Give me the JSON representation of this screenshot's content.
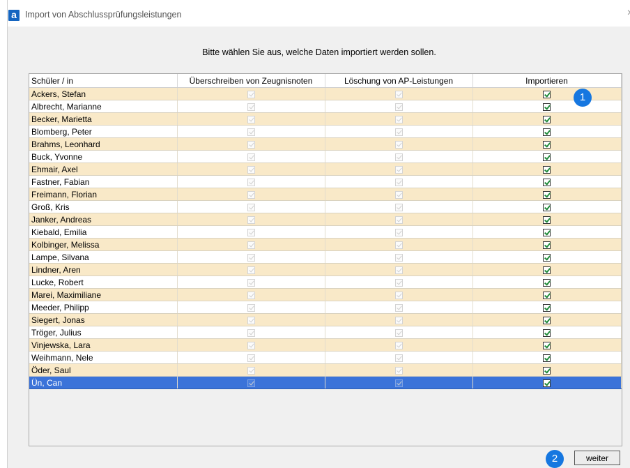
{
  "window": {
    "title": "Import von Abschlussprüfungsleistungen",
    "app_icon_letter": "a",
    "close_glyph": "×"
  },
  "instruction": "Bitte wählen Sie aus, welche Daten importiert werden sollen.",
  "table": {
    "columns": [
      "Schüler / in",
      "Überschreiben von Zeugnisnoten",
      "Löschung von AP-Leistungen",
      "Importieren"
    ],
    "rows": [
      {
        "name": "Ackers, Stefan",
        "ueberschreiben": false,
        "loeschung": false,
        "importieren": true
      },
      {
        "name": "Albrecht, Marianne",
        "ueberschreiben": false,
        "loeschung": false,
        "importieren": true
      },
      {
        "name": "Becker, Marietta",
        "ueberschreiben": false,
        "loeschung": false,
        "importieren": true
      },
      {
        "name": "Blomberg, Peter",
        "ueberschreiben": false,
        "loeschung": false,
        "importieren": true
      },
      {
        "name": "Brahms, Leonhard",
        "ueberschreiben": false,
        "loeschung": false,
        "importieren": true
      },
      {
        "name": "Buck, Yvonne",
        "ueberschreiben": false,
        "loeschung": false,
        "importieren": true
      },
      {
        "name": "Ehmair, Axel",
        "ueberschreiben": false,
        "loeschung": false,
        "importieren": true
      },
      {
        "name": "Fastner, Fabian",
        "ueberschreiben": false,
        "loeschung": false,
        "importieren": true
      },
      {
        "name": "Freimann, Florian",
        "ueberschreiben": false,
        "loeschung": false,
        "importieren": true
      },
      {
        "name": "Groß, Kris",
        "ueberschreiben": false,
        "loeschung": false,
        "importieren": true
      },
      {
        "name": "Janker, Andreas",
        "ueberschreiben": false,
        "loeschung": false,
        "importieren": true
      },
      {
        "name": "Kiebald, Emilia",
        "ueberschreiben": false,
        "loeschung": false,
        "importieren": true
      },
      {
        "name": "Kolbinger, Melissa",
        "ueberschreiben": false,
        "loeschung": false,
        "importieren": true
      },
      {
        "name": "Lampe, Silvana",
        "ueberschreiben": false,
        "loeschung": false,
        "importieren": true
      },
      {
        "name": "Lindner, Aren",
        "ueberschreiben": false,
        "loeschung": false,
        "importieren": true
      },
      {
        "name": "Lucke, Robert",
        "ueberschreiben": false,
        "loeschung": false,
        "importieren": true
      },
      {
        "name": "Marei, Maximiliane",
        "ueberschreiben": false,
        "loeschung": false,
        "importieren": true
      },
      {
        "name": "Meeder, Philipp",
        "ueberschreiben": false,
        "loeschung": false,
        "importieren": true
      },
      {
        "name": "Siegert, Jonas",
        "ueberschreiben": false,
        "loeschung": false,
        "importieren": true
      },
      {
        "name": "Tröger, Julius",
        "ueberschreiben": false,
        "loeschung": false,
        "importieren": true
      },
      {
        "name": "Vinjewska, Lara",
        "ueberschreiben": false,
        "loeschung": false,
        "importieren": true
      },
      {
        "name": "Weihmann, Nele",
        "ueberschreiben": false,
        "loeschung": false,
        "importieren": true
      },
      {
        "name": "Öder, Saul",
        "ueberschreiben": false,
        "loeschung": false,
        "importieren": true
      },
      {
        "name": "Ün, Can",
        "ueberschreiben": false,
        "loeschung": false,
        "importieren": true,
        "selected": true
      }
    ]
  },
  "badges": [
    "1",
    "2"
  ],
  "buttons": {
    "weiter": "weiter"
  },
  "colors": {
    "row_odd": "#f9e9c8",
    "row_even": "#ffffff",
    "row_selected": "#3b73d9",
    "badge": "#1677e0",
    "check_green": "#1f8a3a"
  }
}
